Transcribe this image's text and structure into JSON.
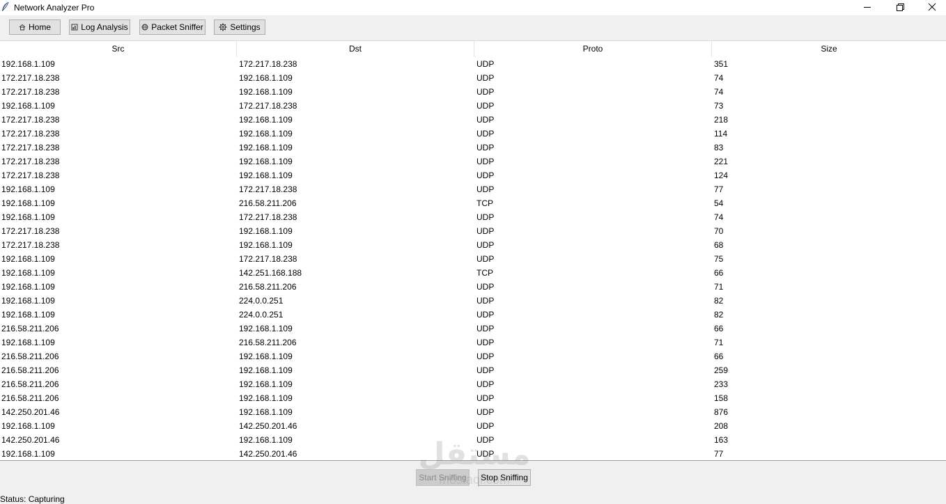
{
  "window": {
    "title": "Network Analyzer Pro",
    "icons": {
      "app": "feather-icon",
      "minimize": "minimize-icon",
      "maximize": "restore-icon",
      "close": "close-icon"
    }
  },
  "toolbar": {
    "home_label": "Home",
    "log_label": "Log Analysis",
    "sniffer_label": "Packet Sniffer",
    "settings_label": "Settings",
    "icons": [
      "home-icon",
      "chart-icon",
      "globe-icon",
      "gear-icon"
    ]
  },
  "table": {
    "columns": [
      "Src",
      "Dst",
      "Proto",
      "Size"
    ],
    "rows": [
      [
        "192.168.1.109",
        "172.217.18.238",
        "UDP",
        "351"
      ],
      [
        "172.217.18.238",
        "192.168.1.109",
        "UDP",
        "74"
      ],
      [
        "172.217.18.238",
        "192.168.1.109",
        "UDP",
        "74"
      ],
      [
        "192.168.1.109",
        "172.217.18.238",
        "UDP",
        "73"
      ],
      [
        "172.217.18.238",
        "192.168.1.109",
        "UDP",
        "218"
      ],
      [
        "172.217.18.238",
        "192.168.1.109",
        "UDP",
        "114"
      ],
      [
        "172.217.18.238",
        "192.168.1.109",
        "UDP",
        "83"
      ],
      [
        "172.217.18.238",
        "192.168.1.109",
        "UDP",
        "221"
      ],
      [
        "172.217.18.238",
        "192.168.1.109",
        "UDP",
        "124"
      ],
      [
        "192.168.1.109",
        "172.217.18.238",
        "UDP",
        "77"
      ],
      [
        "192.168.1.109",
        "216.58.211.206",
        "TCP",
        "54"
      ],
      [
        "192.168.1.109",
        "172.217.18.238",
        "UDP",
        "74"
      ],
      [
        "172.217.18.238",
        "192.168.1.109",
        "UDP",
        "70"
      ],
      [
        "172.217.18.238",
        "192.168.1.109",
        "UDP",
        "68"
      ],
      [
        "192.168.1.109",
        "172.217.18.238",
        "UDP",
        "75"
      ],
      [
        "192.168.1.109",
        "142.251.168.188",
        "TCP",
        "66"
      ],
      [
        "192.168.1.109",
        "216.58.211.206",
        "UDP",
        "71"
      ],
      [
        "192.168.1.109",
        "224.0.0.251",
        "UDP",
        "82"
      ],
      [
        "192.168.1.109",
        "224.0.0.251",
        "UDP",
        "82"
      ],
      [
        "216.58.211.206",
        "192.168.1.109",
        "UDP",
        "66"
      ],
      [
        "192.168.1.109",
        "216.58.211.206",
        "UDP",
        "71"
      ],
      [
        "216.58.211.206",
        "192.168.1.109",
        "UDP",
        "66"
      ],
      [
        "216.58.211.206",
        "192.168.1.109",
        "UDP",
        "259"
      ],
      [
        "216.58.211.206",
        "192.168.1.109",
        "UDP",
        "233"
      ],
      [
        "216.58.211.206",
        "192.168.1.109",
        "UDP",
        "158"
      ],
      [
        "142.250.201.46",
        "192.168.1.109",
        "UDP",
        "876"
      ],
      [
        "192.168.1.109",
        "142.250.201.46",
        "UDP",
        "208"
      ],
      [
        "142.250.201.46",
        "192.168.1.109",
        "UDP",
        "163"
      ],
      [
        "192.168.1.109",
        "142.250.201.46",
        "UDP",
        "77"
      ]
    ]
  },
  "controls": {
    "start_label": "Start Sniffing",
    "stop_label": "Stop Sniffing",
    "start_enabled": false
  },
  "watermark": {
    "arabic": "مستقل",
    "latin": "mostaql.com"
  },
  "status": {
    "text": "Status: Capturing"
  }
}
